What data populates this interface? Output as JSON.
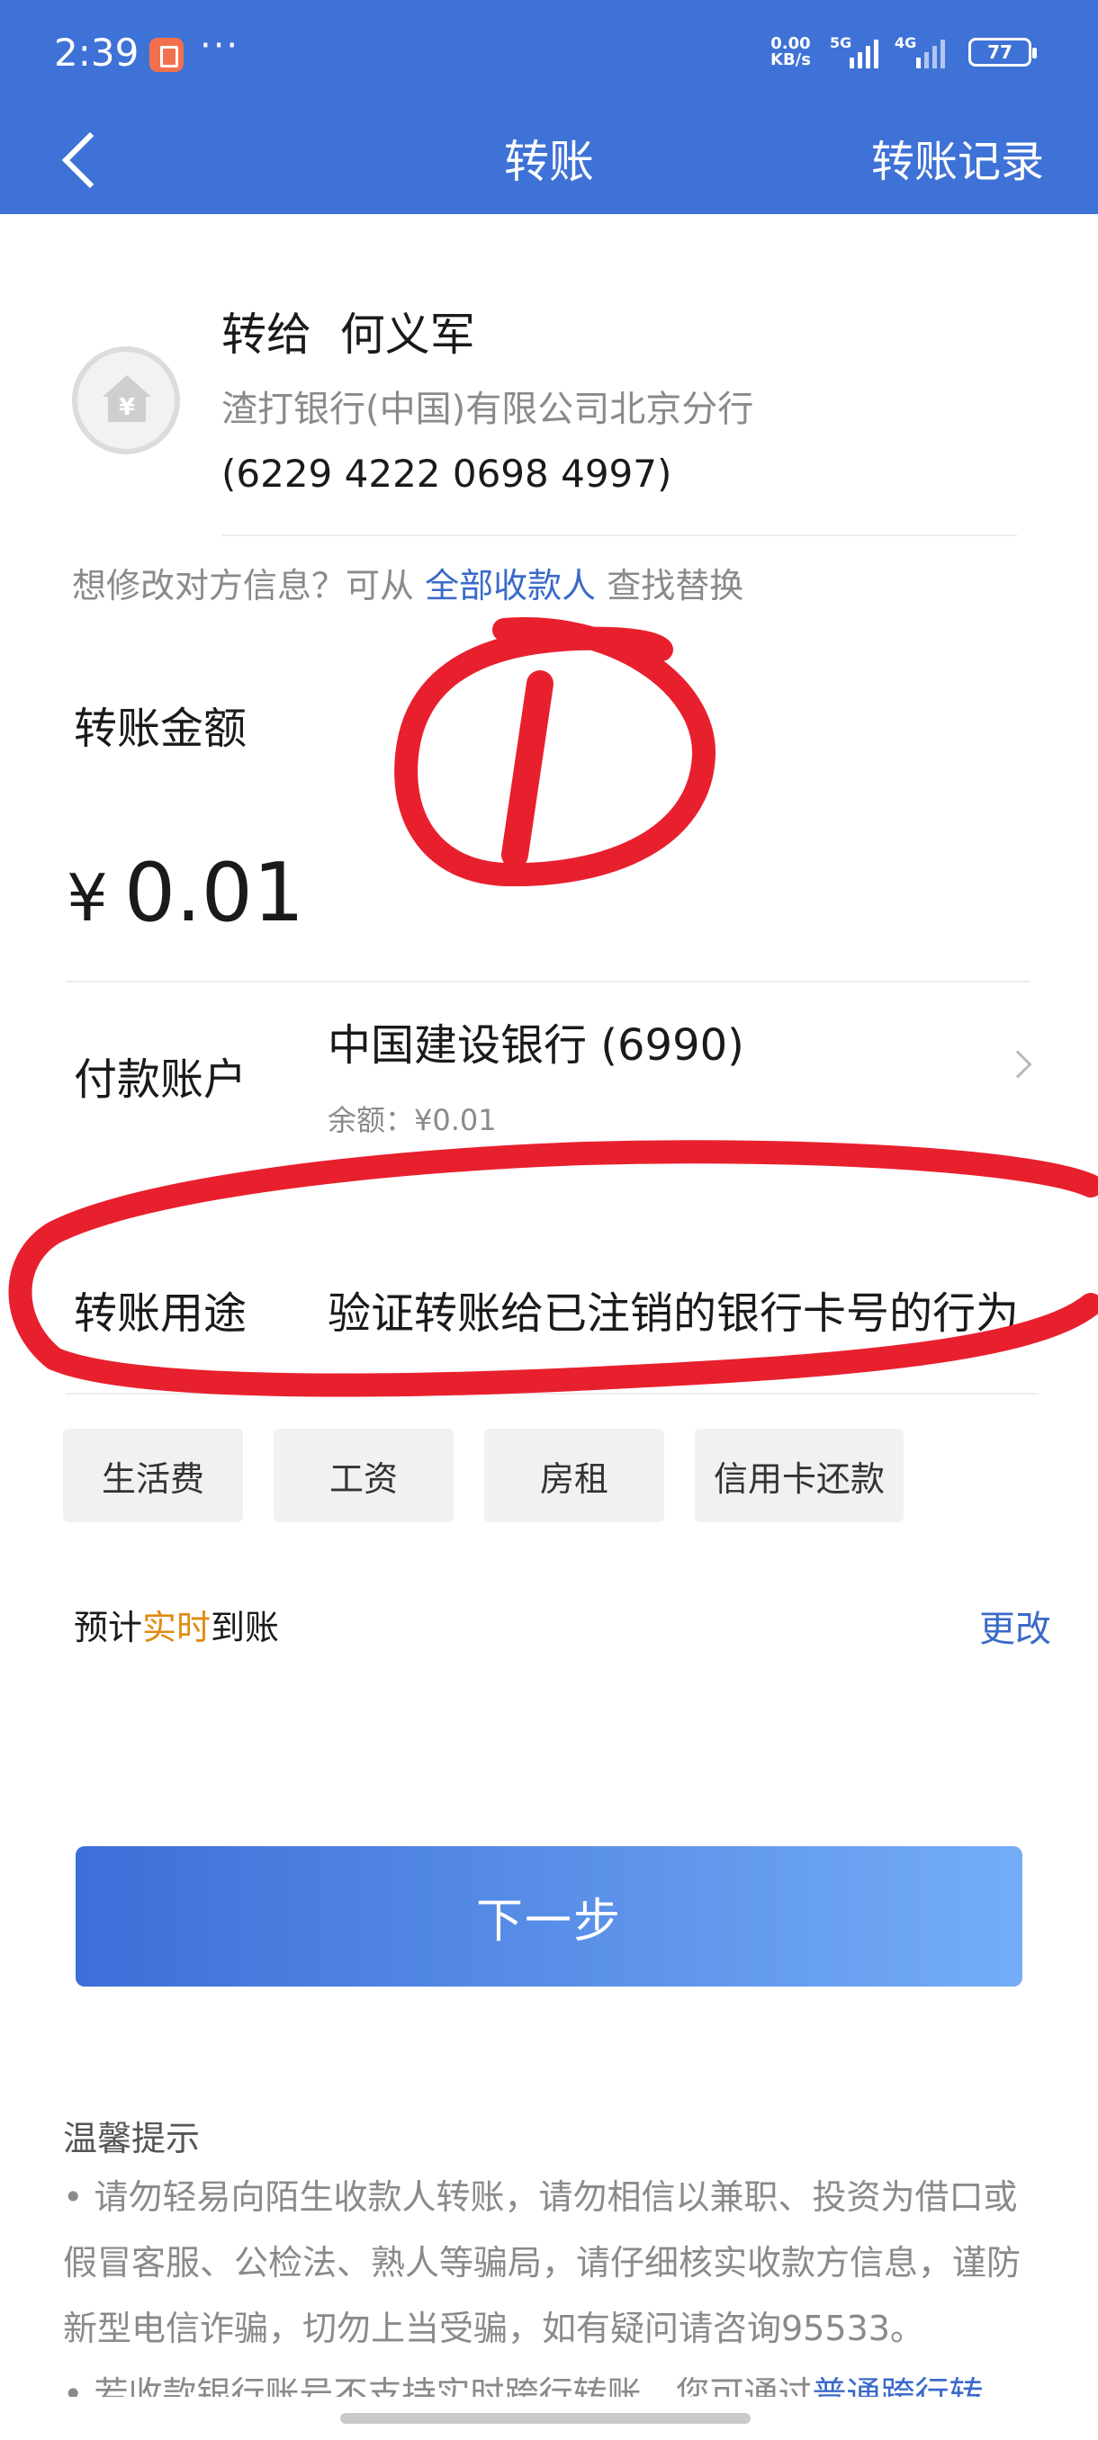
{
  "status_bar": {
    "time": "2:39",
    "more": "···",
    "net_speed_value": "0.00",
    "net_speed_unit": "KB/s",
    "signal_1": "5G",
    "signal_2": "4G",
    "battery": "77"
  },
  "header": {
    "title": "转账",
    "records_label": "转账记录"
  },
  "recipient": {
    "name_line": "转给  何义军",
    "bank": "渣打银行(中国)有限公司北京分行",
    "card": "(6229 4222 0698 4997)"
  },
  "hint": {
    "prefix": "想修改对方信息？可从 ",
    "link": "全部收款人",
    "suffix": " 查找替换"
  },
  "amount": {
    "label": "转账金额",
    "currency": "¥",
    "value": "0.01"
  },
  "payer": {
    "label": "付款账户",
    "bank": "中国建设银行 (6990)",
    "balance": "余额：¥0.01"
  },
  "purpose": {
    "label": "转账用途",
    "value": "验证转账给已注销的银行卡号的行为"
  },
  "chips": [
    "生活费",
    "工资",
    "房租",
    "信用卡还款"
  ],
  "eta": {
    "prefix": "预计",
    "highlight": "实时",
    "suffix": "到账",
    "change_label": "更改"
  },
  "next_button": "下一步",
  "tips": {
    "title": "温馨提示",
    "item1": "请勿轻易向陌生收款人转账，请勿相信以兼职、投资为借口或假冒客服、公检法、熟人等骗局，请仔细核实收款方信息，谨防新型电信诈骗，切勿上当受骗，如有疑问请咨询95533。",
    "item2_prefix": "若收款银行账号不支持实时跨行转账，您可通过",
    "item2_link": "普通跨行转"
  },
  "colors": {
    "header_bg": "#3f72d6",
    "link": "#3a6ac9",
    "highlight": "#e08a12",
    "annotation_red": "#e8202e"
  }
}
